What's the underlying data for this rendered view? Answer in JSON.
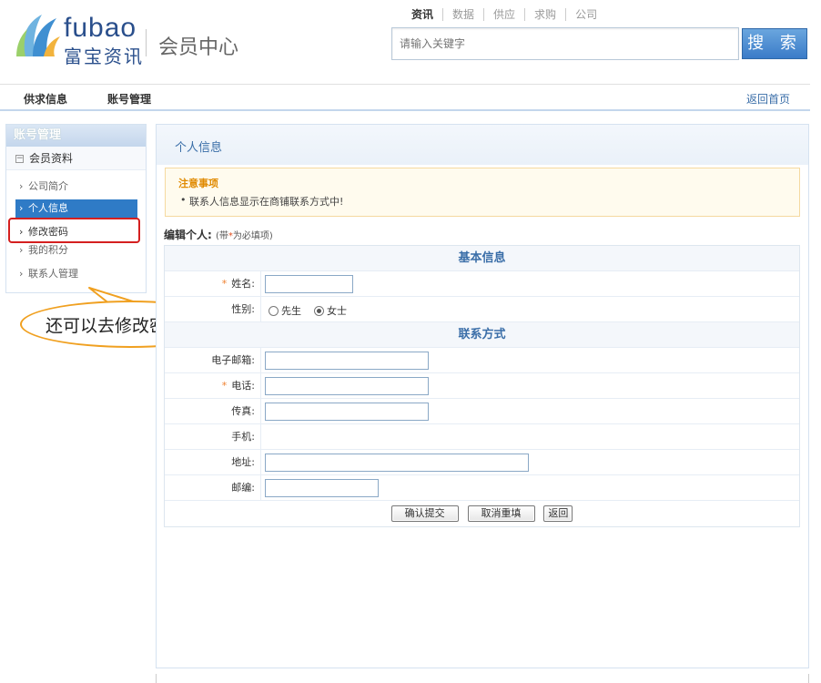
{
  "header": {
    "brand_en": "fubao",
    "brand_cn": "富宝资讯",
    "subtitle": "会员中心",
    "search_tabs": [
      "资讯",
      "数据",
      "供应",
      "求购",
      "公司"
    ],
    "search_placeholder": "请输入关键字",
    "search_button": "搜 索"
  },
  "nav": {
    "items": [
      "供求信息",
      "账号管理"
    ],
    "home": "返回首页"
  },
  "sidebar": {
    "title": "账号管理",
    "group": "会员资料",
    "items": [
      {
        "label": "公司简介"
      },
      {
        "label": "个人信息"
      },
      {
        "label": "修改密码"
      },
      {
        "label": "我的积分"
      },
      {
        "label": "联系人管理"
      }
    ]
  },
  "callout": {
    "text": "还可以去修改密码~"
  },
  "main": {
    "title": "个人信息",
    "notice": {
      "title": "注意事项",
      "body": "联系人信息显示在商铺联系方式中!"
    },
    "edit_head": "编辑个人:",
    "edit_note_prefix": "(带",
    "edit_note_star": "*",
    "edit_note_suffix": "为必填项)",
    "sections": {
      "basic": "基本信息",
      "contact": "联系方式"
    },
    "fields": {
      "name": "姓名:",
      "gender": "性别:",
      "gender_male": "先生",
      "gender_female": "女士",
      "gender_selected": "女士",
      "email": "电子邮箱:",
      "phone": "电话:",
      "fax": "传真:",
      "mobile": "手机:",
      "address": "地址:",
      "zip": "邮编:"
    },
    "buttons": {
      "submit": "确认提交",
      "reset": "取消重填",
      "back": "返回"
    }
  },
  "colors": {
    "brand_blue": "#2a4f8c",
    "accent_blue": "#2f7bc6",
    "highlight_red": "#d41f1f",
    "callout_orange": "#f0a020",
    "required_star": "#f08030"
  }
}
